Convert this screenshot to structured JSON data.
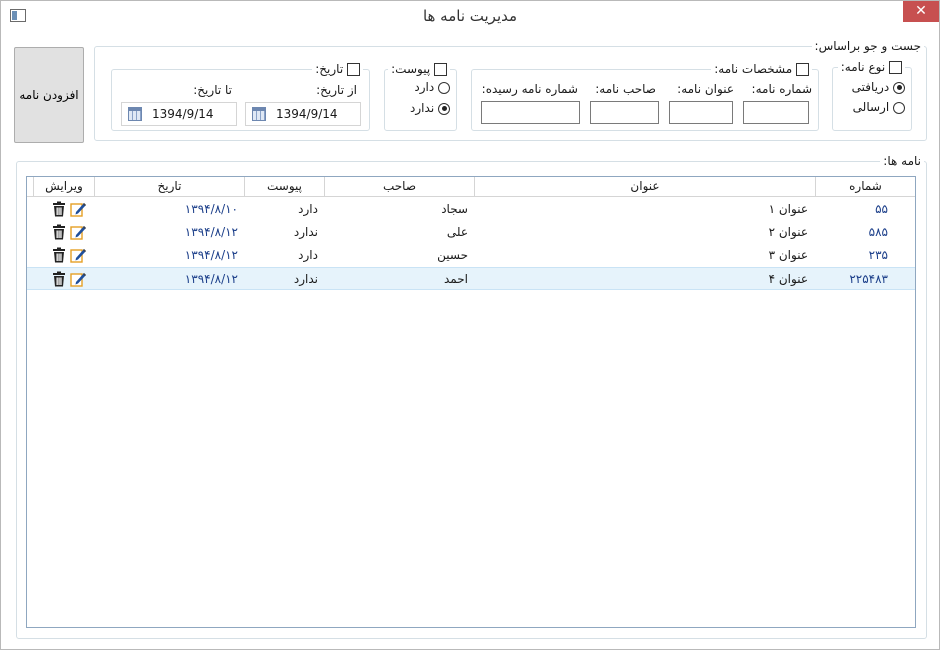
{
  "window": {
    "title": "مدیریت نامه ها",
    "close_glyph": "✕",
    "icon": "app-window-icon"
  },
  "add_button": {
    "label": "افزودن نامه"
  },
  "search": {
    "legend": "جست و جو براساس:",
    "letter_type": {
      "label": "نوع نامه:",
      "options": [
        {
          "label": "دریافتی",
          "selected": true
        },
        {
          "label": "ارسالی",
          "selected": false
        }
      ]
    },
    "letter_specs": {
      "label": "مشخصات نامه:",
      "fields": [
        {
          "label": "شماره نامه:",
          "value": ""
        },
        {
          "label": "عنوان نامه:",
          "value": ""
        },
        {
          "label": "صاحب نامه:",
          "value": ""
        },
        {
          "label": "شماره نامه رسیده:",
          "value": ""
        }
      ]
    },
    "attachment": {
      "label": "پیوست:",
      "options": [
        {
          "label": "دارد",
          "selected": false
        },
        {
          "label": "ندارد",
          "selected": true
        }
      ]
    },
    "date": {
      "label": "تاریخ:",
      "from_label": "از تاریخ:",
      "to_label": "تا تاریخ:",
      "from_value": "1394/9/14",
      "to_value": "1394/9/14",
      "calendar_icon": "calendar-icon"
    }
  },
  "letters": {
    "legend": "نامه ها:",
    "columns": {
      "number": "شماره",
      "title": "عنوان",
      "owner": "صاحب",
      "attachment": "پیوست",
      "date": "تاریخ",
      "edit": "ویرایش"
    },
    "rows": [
      {
        "number": "۵۵",
        "title": "عنوان ۱",
        "owner": "سجاد",
        "attachment": "دارد",
        "date": "۱۳۹۴/۸/۱۰"
      },
      {
        "number": "۵۸۵",
        "title": "عنوان ۲",
        "owner": "علی",
        "attachment": "ندارد",
        "date": "۱۳۹۴/۸/۱۲"
      },
      {
        "number": "۲۳۵",
        "title": "عنوان ۳",
        "owner": "حسین",
        "attachment": "دارد",
        "date": "۱۳۹۴/۸/۱۲"
      },
      {
        "number": "۲۲۵۴۸۳",
        "title": "عنوان ۴",
        "owner": "احمد",
        "attachment": "ندارد",
        "date": "۱۳۹۴/۸/۱۲"
      }
    ],
    "selected_row": 3,
    "row_icons": [
      "delete-trash-icon",
      "edit-pencil-icon"
    ]
  },
  "colors": {
    "accent": "#8fa7c0",
    "selection": "#e6f3fb",
    "close_button": "#c75050",
    "number_text": "#1c3f8a"
  }
}
